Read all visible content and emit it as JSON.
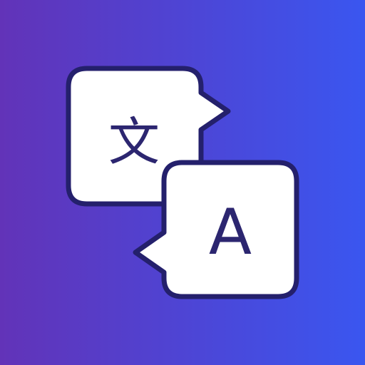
{
  "icon": {
    "name": "translate-app-icon",
    "gradient": {
      "start": "#6233b8",
      "end": "#3a56f0"
    },
    "bubble_fill": "#ffffff",
    "outline_color": "#24206c",
    "glyph_color": "#2c2670",
    "source_glyph": "文",
    "target_glyph": "A"
  }
}
